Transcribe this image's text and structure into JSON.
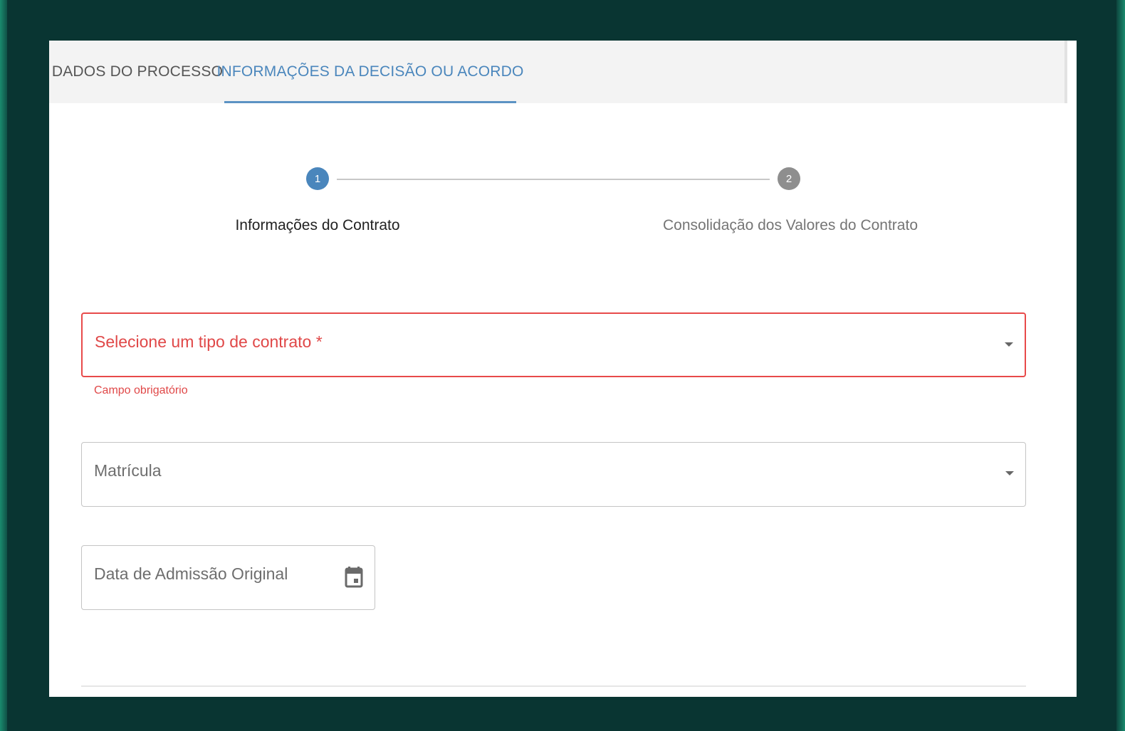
{
  "tabs": [
    {
      "label": "DADOS DO PROCESSO",
      "active": false
    },
    {
      "label": "INFORMAÇÕES DA DECISÃO OU ACORDO",
      "active": true
    }
  ],
  "stepper": {
    "steps": [
      {
        "number": "1",
        "label": "Informações do Contrato",
        "state": "active"
      },
      {
        "number": "2",
        "label": "Consolidação dos Valores do Contrato",
        "state": "inactive"
      }
    ]
  },
  "form": {
    "contract_type": {
      "label": "Selecione um tipo de contrato *",
      "error": "Campo obrigatório",
      "icon": "chevron-down-icon"
    },
    "matricula": {
      "label": "Matrícula",
      "icon": "chevron-down-icon"
    },
    "admission_date": {
      "label": "Data de Admissão Original",
      "icon": "calendar-icon"
    }
  },
  "colors": {
    "accent": "#4a86bc",
    "error": "#e04848",
    "inactive_step": "#8e8e8e",
    "background": "#093532"
  }
}
